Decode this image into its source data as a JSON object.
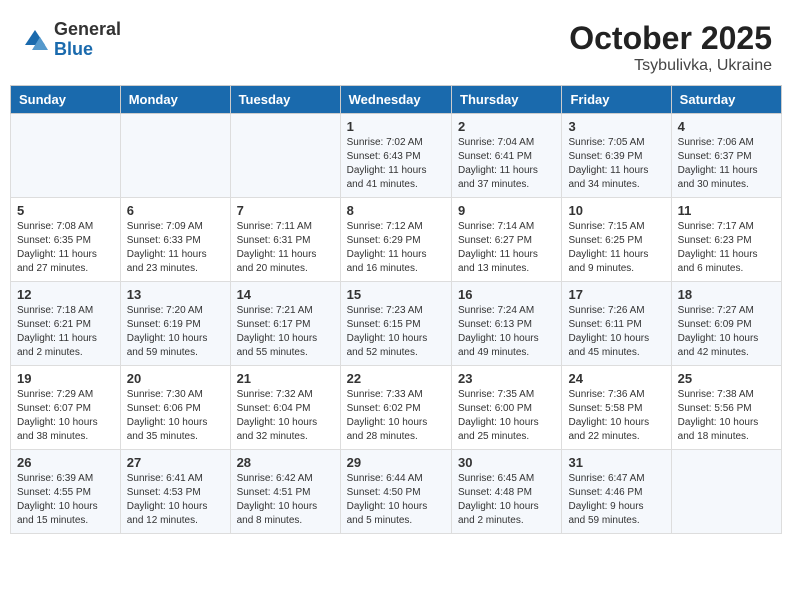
{
  "header": {
    "logo_general": "General",
    "logo_blue": "Blue",
    "month_year": "October 2025",
    "location": "Tsybulivka, Ukraine"
  },
  "weekdays": [
    "Sunday",
    "Monday",
    "Tuesday",
    "Wednesday",
    "Thursday",
    "Friday",
    "Saturday"
  ],
  "weeks": [
    [
      {
        "day": "",
        "info": ""
      },
      {
        "day": "",
        "info": ""
      },
      {
        "day": "",
        "info": ""
      },
      {
        "day": "1",
        "info": "Sunrise: 7:02 AM\nSunset: 6:43 PM\nDaylight: 11 hours\nand 41 minutes."
      },
      {
        "day": "2",
        "info": "Sunrise: 7:04 AM\nSunset: 6:41 PM\nDaylight: 11 hours\nand 37 minutes."
      },
      {
        "day": "3",
        "info": "Sunrise: 7:05 AM\nSunset: 6:39 PM\nDaylight: 11 hours\nand 34 minutes."
      },
      {
        "day": "4",
        "info": "Sunrise: 7:06 AM\nSunset: 6:37 PM\nDaylight: 11 hours\nand 30 minutes."
      }
    ],
    [
      {
        "day": "5",
        "info": "Sunrise: 7:08 AM\nSunset: 6:35 PM\nDaylight: 11 hours\nand 27 minutes."
      },
      {
        "day": "6",
        "info": "Sunrise: 7:09 AM\nSunset: 6:33 PM\nDaylight: 11 hours\nand 23 minutes."
      },
      {
        "day": "7",
        "info": "Sunrise: 7:11 AM\nSunset: 6:31 PM\nDaylight: 11 hours\nand 20 minutes."
      },
      {
        "day": "8",
        "info": "Sunrise: 7:12 AM\nSunset: 6:29 PM\nDaylight: 11 hours\nand 16 minutes."
      },
      {
        "day": "9",
        "info": "Sunrise: 7:14 AM\nSunset: 6:27 PM\nDaylight: 11 hours\nand 13 minutes."
      },
      {
        "day": "10",
        "info": "Sunrise: 7:15 AM\nSunset: 6:25 PM\nDaylight: 11 hours\nand 9 minutes."
      },
      {
        "day": "11",
        "info": "Sunrise: 7:17 AM\nSunset: 6:23 PM\nDaylight: 11 hours\nand 6 minutes."
      }
    ],
    [
      {
        "day": "12",
        "info": "Sunrise: 7:18 AM\nSunset: 6:21 PM\nDaylight: 11 hours\nand 2 minutes."
      },
      {
        "day": "13",
        "info": "Sunrise: 7:20 AM\nSunset: 6:19 PM\nDaylight: 10 hours\nand 59 minutes."
      },
      {
        "day": "14",
        "info": "Sunrise: 7:21 AM\nSunset: 6:17 PM\nDaylight: 10 hours\nand 55 minutes."
      },
      {
        "day": "15",
        "info": "Sunrise: 7:23 AM\nSunset: 6:15 PM\nDaylight: 10 hours\nand 52 minutes."
      },
      {
        "day": "16",
        "info": "Sunrise: 7:24 AM\nSunset: 6:13 PM\nDaylight: 10 hours\nand 49 minutes."
      },
      {
        "day": "17",
        "info": "Sunrise: 7:26 AM\nSunset: 6:11 PM\nDaylight: 10 hours\nand 45 minutes."
      },
      {
        "day": "18",
        "info": "Sunrise: 7:27 AM\nSunset: 6:09 PM\nDaylight: 10 hours\nand 42 minutes."
      }
    ],
    [
      {
        "day": "19",
        "info": "Sunrise: 7:29 AM\nSunset: 6:07 PM\nDaylight: 10 hours\nand 38 minutes."
      },
      {
        "day": "20",
        "info": "Sunrise: 7:30 AM\nSunset: 6:06 PM\nDaylight: 10 hours\nand 35 minutes."
      },
      {
        "day": "21",
        "info": "Sunrise: 7:32 AM\nSunset: 6:04 PM\nDaylight: 10 hours\nand 32 minutes."
      },
      {
        "day": "22",
        "info": "Sunrise: 7:33 AM\nSunset: 6:02 PM\nDaylight: 10 hours\nand 28 minutes."
      },
      {
        "day": "23",
        "info": "Sunrise: 7:35 AM\nSunset: 6:00 PM\nDaylight: 10 hours\nand 25 minutes."
      },
      {
        "day": "24",
        "info": "Sunrise: 7:36 AM\nSunset: 5:58 PM\nDaylight: 10 hours\nand 22 minutes."
      },
      {
        "day": "25",
        "info": "Sunrise: 7:38 AM\nSunset: 5:56 PM\nDaylight: 10 hours\nand 18 minutes."
      }
    ],
    [
      {
        "day": "26",
        "info": "Sunrise: 6:39 AM\nSunset: 4:55 PM\nDaylight: 10 hours\nand 15 minutes."
      },
      {
        "day": "27",
        "info": "Sunrise: 6:41 AM\nSunset: 4:53 PM\nDaylight: 10 hours\nand 12 minutes."
      },
      {
        "day": "28",
        "info": "Sunrise: 6:42 AM\nSunset: 4:51 PM\nDaylight: 10 hours\nand 8 minutes."
      },
      {
        "day": "29",
        "info": "Sunrise: 6:44 AM\nSunset: 4:50 PM\nDaylight: 10 hours\nand 5 minutes."
      },
      {
        "day": "30",
        "info": "Sunrise: 6:45 AM\nSunset: 4:48 PM\nDaylight: 10 hours\nand 2 minutes."
      },
      {
        "day": "31",
        "info": "Sunrise: 6:47 AM\nSunset: 4:46 PM\nDaylight: 9 hours\nand 59 minutes."
      },
      {
        "day": "",
        "info": ""
      }
    ]
  ]
}
